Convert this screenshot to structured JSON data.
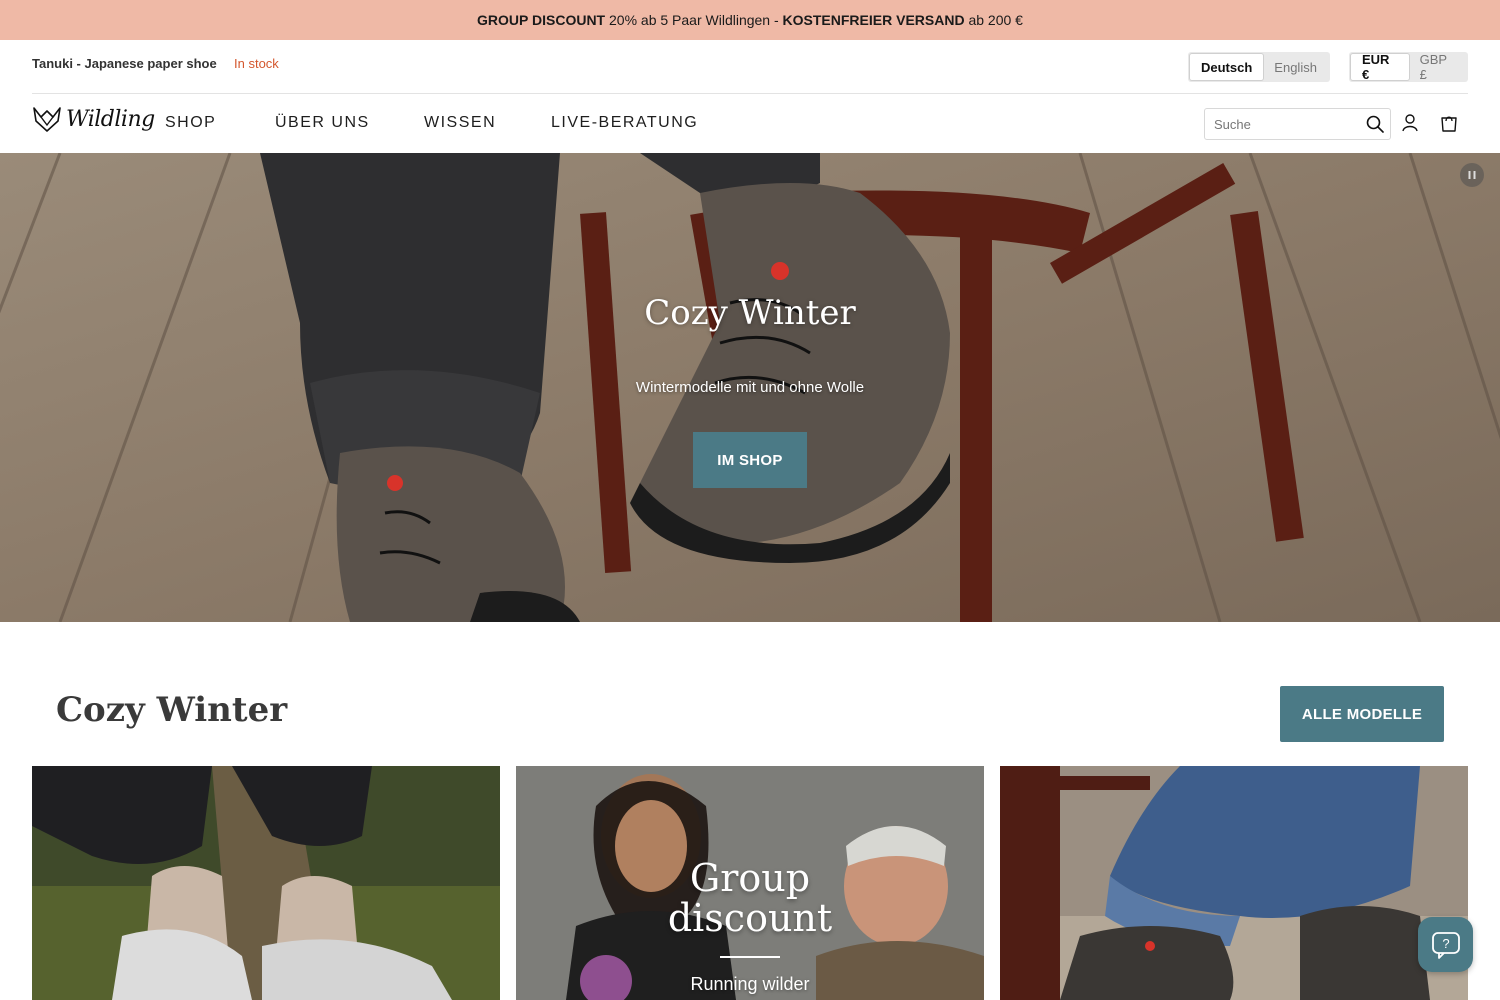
{
  "announcement": {
    "part1_bold": "GROUP DISCOUNT",
    "part2": " 20% ab 5 Paar Wildlingen - ",
    "part3_bold": "KOSTENFREIER VERSAND",
    "part4": " ab 200 €"
  },
  "utility": {
    "product_name": "Tanuki - Japanese paper shoe",
    "stock_status": "In stock",
    "languages": [
      {
        "label": "Deutsch",
        "active": true
      },
      {
        "label": "English",
        "active": false
      }
    ],
    "currencies": [
      {
        "label": "EUR €",
        "active": true
      },
      {
        "label": "GBP £",
        "active": false
      }
    ]
  },
  "header": {
    "logo_text": "Wildling",
    "nav": [
      "SHOP",
      "ÜBER UNS",
      "WISSEN",
      "LIVE-BERATUNG"
    ],
    "search_placeholder": "Suche",
    "icons": [
      "search-icon",
      "account-icon",
      "cart-icon"
    ]
  },
  "hero": {
    "title": "Cozy Winter",
    "subtitle": "Wintermodelle mit und ohne Wolle",
    "button": "IM SHOP",
    "button_color": "#4b7a86"
  },
  "section": {
    "title": "Cozy Winter",
    "button": "ALLE MODELLE"
  },
  "cards": {
    "promo": {
      "title": "Group\ndiscount",
      "subtitle": "Running wilder"
    }
  },
  "colors": {
    "announcement_bg": "#efb9a6",
    "accent": "#4b7a86",
    "stock": "#d4572e"
  }
}
